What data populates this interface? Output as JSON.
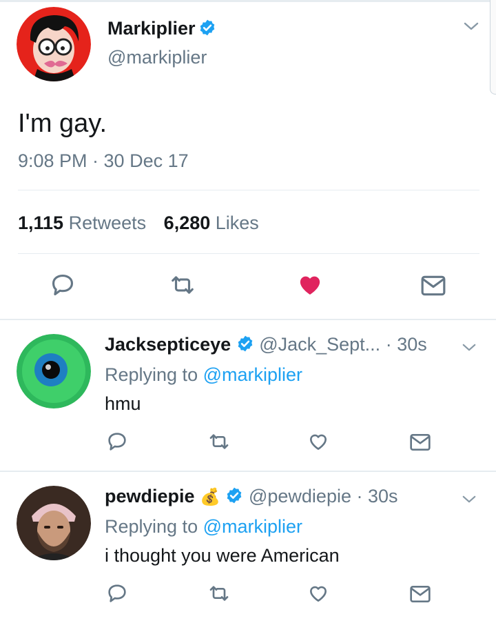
{
  "main_tweet": {
    "name": "Markiplier",
    "handle": "@markiplier",
    "text": "I'm gay.",
    "timestamp": "9:08 PM · 30 Dec 17",
    "retweets_count": "1,115",
    "retweets_label": "Retweets",
    "likes_count": "6,280",
    "likes_label": "Likes",
    "liked": true
  },
  "replies": [
    {
      "name": "Jacksepticeye",
      "handle": "@Jack_Sept...",
      "time": "· 30s",
      "replying_prefix": "Replying to",
      "replying_to": "@markiplier",
      "text": "hmu"
    },
    {
      "name": "pewdiepie",
      "name_emoji": "💰",
      "handle": "@pewdiepie",
      "time": "· 30s",
      "replying_prefix": "Replying to",
      "replying_to": "@markiplier",
      "text": "i thought you were American"
    }
  ],
  "colors": {
    "accent": "#1da1f2",
    "like": "#e0245e",
    "muted": "#657786",
    "icon": "#657786"
  },
  "icons": [
    "reply-icon",
    "retweet-icon",
    "like-icon",
    "dm-icon",
    "verified-icon",
    "chevron-down-icon"
  ]
}
